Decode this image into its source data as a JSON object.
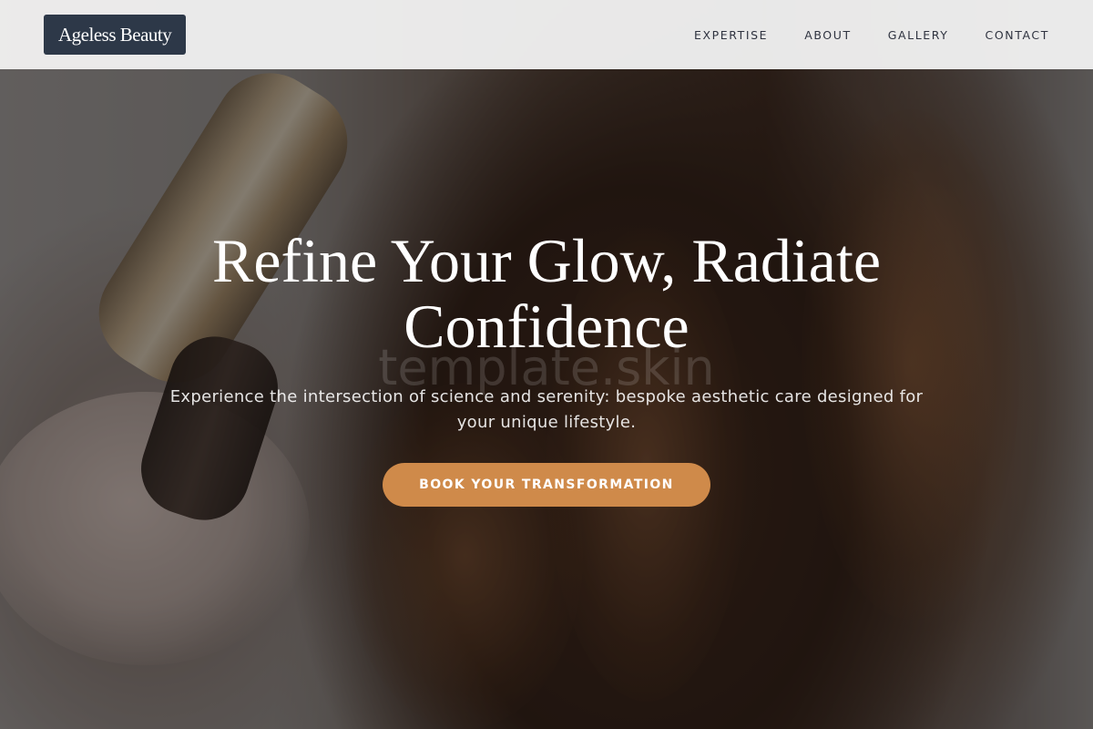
{
  "header": {
    "logo_text": "Ageless Beauty",
    "nav": [
      {
        "label": "EXPERTISE"
      },
      {
        "label": "ABOUT"
      },
      {
        "label": "GALLERY"
      },
      {
        "label": "CONTACT"
      }
    ]
  },
  "hero": {
    "title": "Refine Your Glow, Radiate Confidence",
    "subtitle": "Experience the intersection of science and serenity: bespoke aesthetic care designed for your unique lifestyle.",
    "cta_label": "BOOK YOUR TRANSFORMATION",
    "watermark": "template.skin"
  },
  "colors": {
    "header_bg": "#f0f0f0",
    "logo_bg": "#2d3848",
    "accent": "#cf8a4a",
    "text_light": "#ffffff"
  }
}
